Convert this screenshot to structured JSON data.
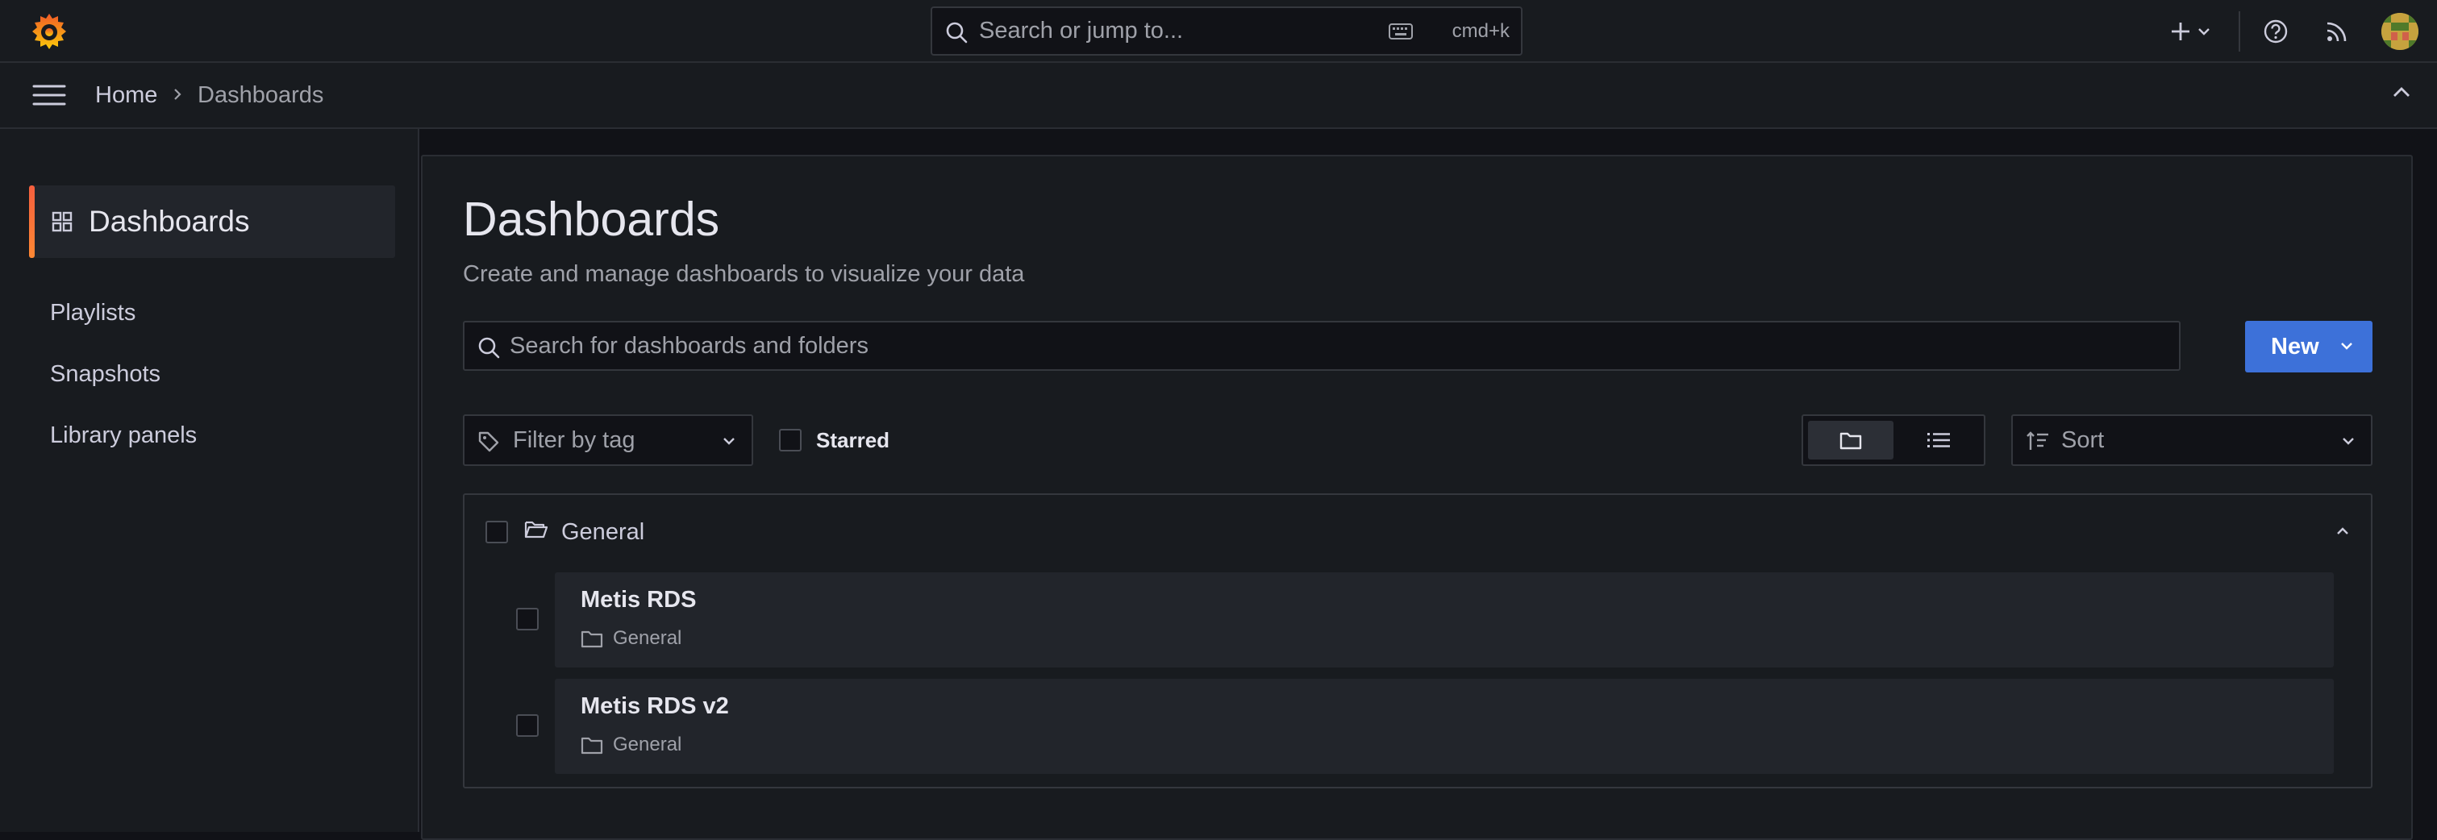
{
  "topbar": {
    "search_placeholder": "Search or jump to...",
    "shortcut": "cmd+k"
  },
  "breadcrumb": {
    "home": "Home",
    "current": "Dashboards"
  },
  "sidenav": {
    "active": "Dashboards",
    "items": [
      {
        "label": "Playlists"
      },
      {
        "label": "Snapshots"
      },
      {
        "label": "Library panels"
      }
    ]
  },
  "page": {
    "title": "Dashboards",
    "subtitle": "Create and manage dashboards to visualize your data",
    "search_placeholder": "Search for dashboards and folders",
    "new_button": "New",
    "tag_filter_placeholder": "Filter by tag",
    "starred_label": "Starred",
    "sort_label": "Sort"
  },
  "folder": {
    "name": "General",
    "dashboards": [
      {
        "title": "Metis RDS",
        "location": "General"
      },
      {
        "title": "Metis RDS v2",
        "location": "General"
      }
    ]
  },
  "colors": {
    "accent": "#3d71d9",
    "active_indicator": "#f55f3e",
    "background": "#111217",
    "panel": "#181b1f"
  }
}
